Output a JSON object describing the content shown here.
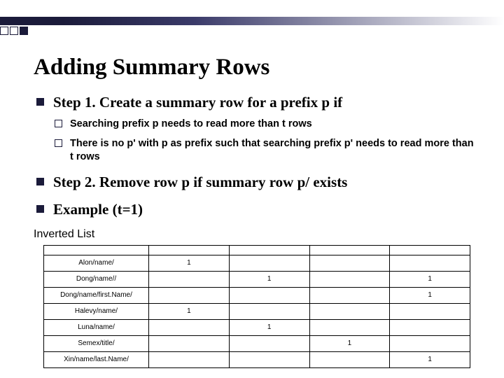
{
  "title": "Adding Summary Rows",
  "bullets": [
    {
      "text": "Step 1. Create a summary row for a prefix p if",
      "sub": [
        "Searching prefix p needs to read more than t rows",
        "There is no p' with p as prefix such that searching prefix p' needs to read more than t rows"
      ]
    },
    {
      "text": "Step 2. Remove row p if summary row p/ exists"
    },
    {
      "text": "Example (t=1)"
    }
  ],
  "table_label": "Inverted List",
  "table": {
    "columns": 5,
    "rows": [
      {
        "label": "Alon/name/",
        "marks": [
          1,
          null,
          null,
          null
        ]
      },
      {
        "label": "Dong/name//",
        "marks": [
          null,
          1,
          null,
          1
        ]
      },
      {
        "label": "Dong/name/first.Name/",
        "marks": [
          null,
          null,
          null,
          1
        ]
      },
      {
        "label": "Halevy/name/",
        "marks": [
          1,
          null,
          null,
          null
        ]
      },
      {
        "label": "Luna/name/",
        "marks": [
          null,
          1,
          null,
          null
        ]
      },
      {
        "label": "Semex/title/",
        "marks": [
          null,
          null,
          1,
          null
        ]
      },
      {
        "label": "Xin/name/last.Name/",
        "marks": [
          null,
          null,
          null,
          1
        ]
      }
    ]
  }
}
